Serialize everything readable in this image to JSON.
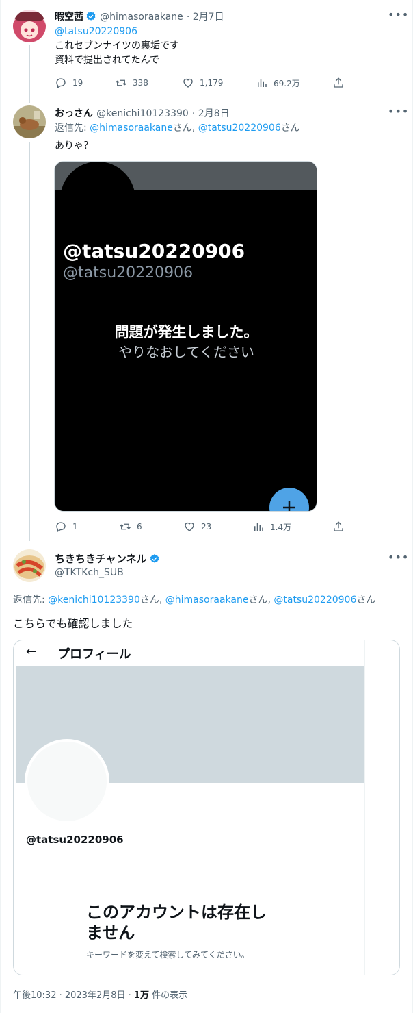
{
  "tweets": [
    {
      "name": "暇空茜",
      "handle": "@himasoraakane",
      "date": "· 2月7日",
      "mention": "@tatsu20220906",
      "lines": [
        "これセブンナイツの裏垢です",
        "資料で提出されてたんで"
      ],
      "replies": "19",
      "retweets": "338",
      "likes": "1,179",
      "views": "69.2万"
    },
    {
      "name": "おっさん",
      "handle": "@kenichi10123390",
      "date": "· 2月8日",
      "reply_prefix": "返信先:",
      "reply_to_1": "@himasoraakane",
      "reply_suffix_1": "さん,",
      "reply_to_2": "@tatsu20220906",
      "reply_suffix_2": "さん",
      "text": "ありゃ？",
      "media": {
        "handle_large": "@tatsu20220906",
        "handle_small": "@tatsu20220906",
        "error_title": "問題が発生しました。",
        "error_sub": "やりなおしてください"
      },
      "replies": "1",
      "retweets": "6",
      "likes": "23",
      "views": "1.4万"
    },
    {
      "name": "ちきちきチャンネル",
      "handle": "@TKTKch_SUB",
      "reply_prefix": "返信先:",
      "reply_to_1": "@kenichi10123390",
      "reply_suffix_1": "さん,",
      "reply_to_2": "@himasoraakane",
      "reply_suffix_2": "さん,",
      "reply_to_3": "@tatsu20220906",
      "reply_suffix_3": "さん",
      "text": "こちらでも確認しました",
      "card": {
        "back_arrow": "←",
        "header": "プロフィール",
        "handle": "@tatsu20220906",
        "title_line1": "このアカウントは存在し",
        "title_line2": "ません",
        "subtitle": "キーワードを変えて検索してみてください。"
      },
      "time": "午後10:32 · 2023年2月8日 ·",
      "views_count": "1万",
      "views_label": "件の表示"
    }
  ],
  "colors": {
    "accent": "#1d9bf0",
    "secondary_text": "#536471",
    "banner": "#cfd9de"
  },
  "icons": [
    "more-icon",
    "reply-icon",
    "retweet-icon",
    "like-icon",
    "views-icon",
    "share-icon",
    "verified-icon",
    "plus-icon",
    "back-arrow-icon"
  ]
}
